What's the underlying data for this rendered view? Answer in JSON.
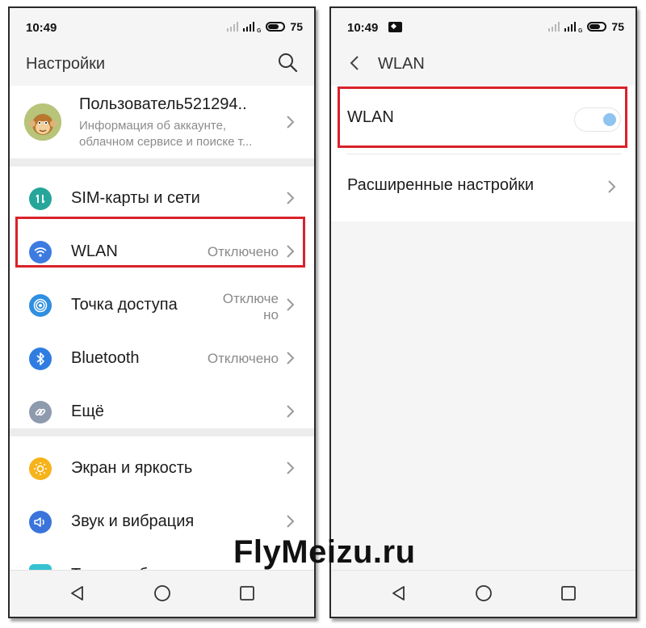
{
  "left_screen": {
    "status": {
      "time": "10:49",
      "battery": "75"
    },
    "header": {
      "title": "Настройки"
    },
    "profile": {
      "name": "Пользователь521294..",
      "sub_line1": "Информация об аккаунте,",
      "sub_line2": "облачном сервисе и поиске т..."
    },
    "items": [
      {
        "label": "SIM-карты и сети",
        "value": "",
        "icon": "sim-cards-icon"
      },
      {
        "label": "WLAN",
        "value": "Отключено",
        "icon": "wifi-icon"
      },
      {
        "label": "Точка доступа",
        "value_line1": "Отключе",
        "value_line2": "но",
        "icon": "hotspot-icon"
      },
      {
        "label": "Bluetooth",
        "value": "Отключено",
        "icon": "bluetooth-icon"
      },
      {
        "label": "Ещё",
        "value": "",
        "icon": "link-icon"
      },
      {
        "label": "Экран и яркость",
        "value": "",
        "icon": "brightness-icon"
      },
      {
        "label": "Звук и вибрация",
        "value": "",
        "icon": "sound-icon"
      },
      {
        "label": "Темы и обои",
        "value": "",
        "icon": "themes-icon"
      }
    ]
  },
  "right_screen": {
    "status": {
      "time": "10:49",
      "battery": "75"
    },
    "header": {
      "title": "WLAN"
    },
    "wlan_toggle": {
      "label": "WLAN",
      "state": "off"
    },
    "advanced": {
      "label": "Расширенные настройки"
    }
  },
  "watermark": "FlyMeizu.ru",
  "colors": {
    "highlight_box": "#d9222a",
    "sim_icon": "#26a69a",
    "wifi_icon": "#3d7be0",
    "hotspot_icon": "#2f8fe0",
    "bluetooth_icon": "#2f7de0",
    "link_icon": "#8e9aad",
    "brightness_icon": "#f6b31b",
    "sound_icon": "#3a74db"
  }
}
